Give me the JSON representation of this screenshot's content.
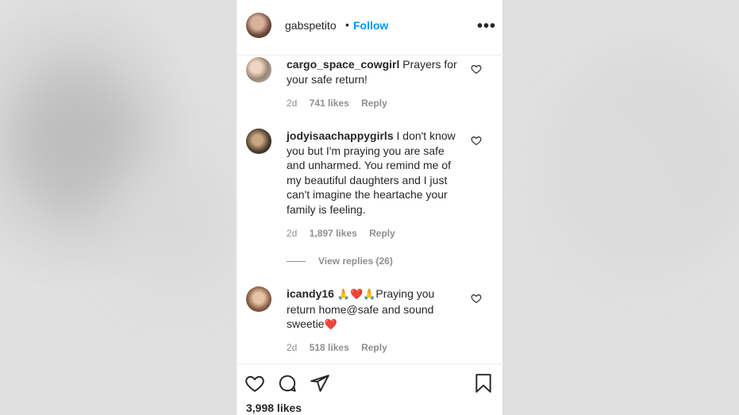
{
  "header": {
    "username": "gabspetito",
    "separator": "•",
    "follow_label": "Follow",
    "more_label": "•••"
  },
  "comments": [
    {
      "username": "cargo_space_cowgirl",
      "text": "Prayers for your safe return!",
      "age": "2d",
      "likes": "741 likes",
      "reply": "Reply"
    },
    {
      "username": "jodyisaachappygirls",
      "text": "I don't know you but I'm praying you are safe and unharmed. You remind me of my beautiful daughters and I just can't imagine the heartache your family is feeling.",
      "age": "2d",
      "likes": "1,897 likes",
      "reply": "Reply",
      "view_replies": "View replies (26)"
    },
    {
      "username": "icandy16",
      "text_pre": "🙏❤️🙏",
      "text": "Praying you return home@safe and sound sweetie",
      "text_post": "❤️",
      "age": "2d",
      "likes": "518 likes",
      "reply": "Reply"
    }
  ],
  "footer": {
    "likes_total": "3,998 likes"
  },
  "icons": {
    "heart": "heart-outline-icon",
    "comment": "comment-icon",
    "share": "paper-plane-icon",
    "save": "bookmark-icon",
    "more": "more-dots-icon"
  },
  "colors": {
    "link": "#0095f6",
    "text": "#262626",
    "muted": "#8e8e8e",
    "heart_emoji": "#e0245e"
  }
}
